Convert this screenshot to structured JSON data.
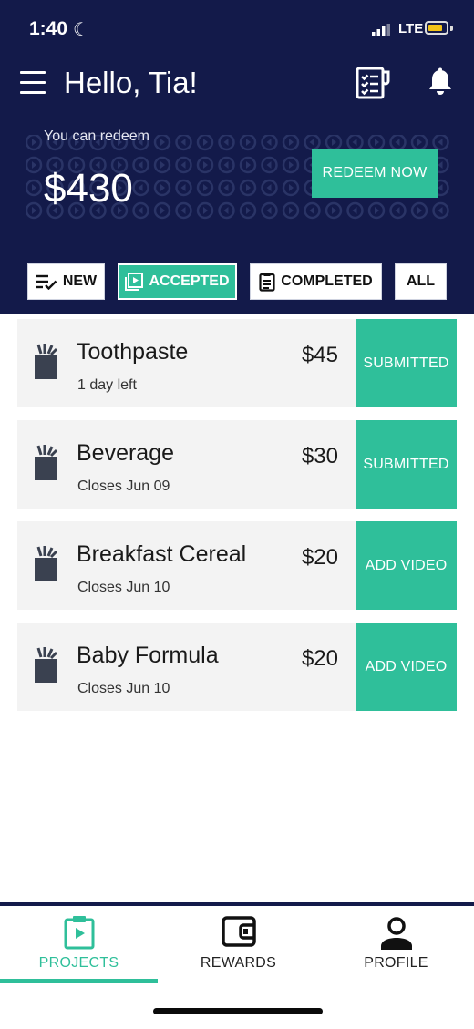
{
  "status_bar": {
    "time": "1:40",
    "network": "LTE"
  },
  "header": {
    "greeting": "Hello, Tia!",
    "redeem_label": "You can redeem",
    "redeem_amount": "$430",
    "redeem_button": "REDEEM NOW"
  },
  "filters": [
    {
      "label": "NEW",
      "icon": "list-check-icon",
      "active": false
    },
    {
      "label": "ACCEPTED",
      "icon": "play-icon",
      "active": true
    },
    {
      "label": "COMPLETED",
      "icon": "clipboard-icon",
      "active": false
    },
    {
      "label": "ALL",
      "active": false
    }
  ],
  "projects": [
    {
      "title": "Toothpaste",
      "subtitle": "1 day left",
      "price": "$45",
      "action": "SUBMITTED"
    },
    {
      "title": "Beverage",
      "subtitle": "Closes Jun 09",
      "price": "$30",
      "action": "SUBMITTED"
    },
    {
      "title": "Breakfast Cereal",
      "subtitle": "Closes Jun 10",
      "price": "$20",
      "action": "ADD VIDEO"
    },
    {
      "title": "Baby Formula",
      "subtitle": "Closes Jun 10",
      "price": "$20",
      "action": "ADD VIDEO"
    }
  ],
  "nav": [
    {
      "label": "PROJECTS",
      "icon": "clipboard-play-icon",
      "active": true
    },
    {
      "label": "REWARDS",
      "icon": "wallet-icon",
      "active": false
    },
    {
      "label": "PROFILE",
      "icon": "person-icon",
      "active": false
    }
  ],
  "colors": {
    "navy": "#131a4a",
    "accent": "#2fbf9a",
    "card": "#f3f3f3"
  }
}
